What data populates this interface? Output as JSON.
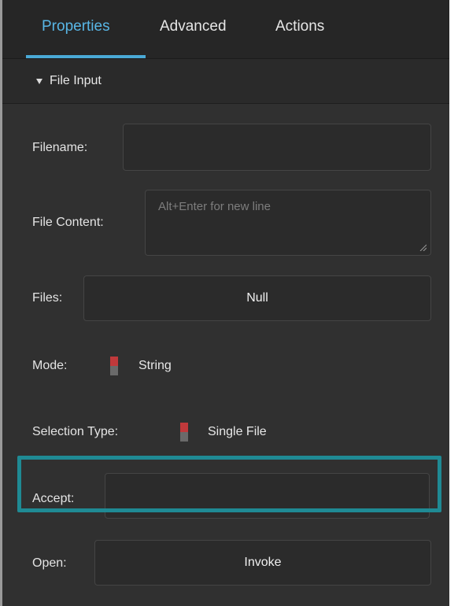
{
  "tabs": [
    {
      "label": "Properties",
      "active": true
    },
    {
      "label": "Advanced",
      "active": false
    },
    {
      "label": "Actions",
      "active": false
    }
  ],
  "section": {
    "title": "File Input",
    "expanded": true
  },
  "fields": {
    "filename": {
      "label": "Filename:",
      "value": ""
    },
    "file_content": {
      "label": "File Content:",
      "placeholder": "Alt+Enter for new line",
      "value": ""
    },
    "files": {
      "label": "Files:",
      "value": "Null"
    },
    "mode": {
      "label": "Mode:",
      "value": "String"
    },
    "selection_type": {
      "label": "Selection Type:",
      "value": "Single File"
    },
    "accept": {
      "label": "Accept:",
      "value": ""
    },
    "open": {
      "label": "Open:",
      "value": "Invoke"
    }
  },
  "colors": {
    "panel_bg": "#303030",
    "tab_active": "#58b6e6",
    "toggle_on": "#c0393b",
    "toggle_off": "#6a6a6a",
    "highlight": "#1f8a94"
  }
}
